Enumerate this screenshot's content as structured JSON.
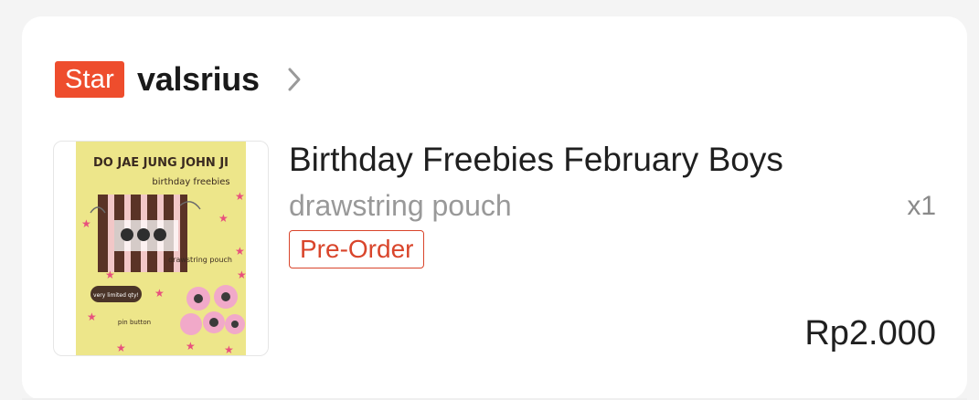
{
  "shop": {
    "badge": "Star",
    "name": "valsrius"
  },
  "product": {
    "title": "Birthday Freebies February Boys",
    "variant": "drawstring pouch",
    "quantity": "x1",
    "tag": "Pre-Order",
    "price": "Rp2.000",
    "image": {
      "header": "DO JAE JUNG JOHN JI",
      "subheader": "birthday freebies",
      "label_pouch": "drawstring pouch",
      "label_pill": "very limited qty!",
      "label_pin": "pin button"
    }
  },
  "colors": {
    "accent": "#ee4d2d",
    "tag": "#d9452b",
    "thumb_bg": "#ede68a"
  }
}
